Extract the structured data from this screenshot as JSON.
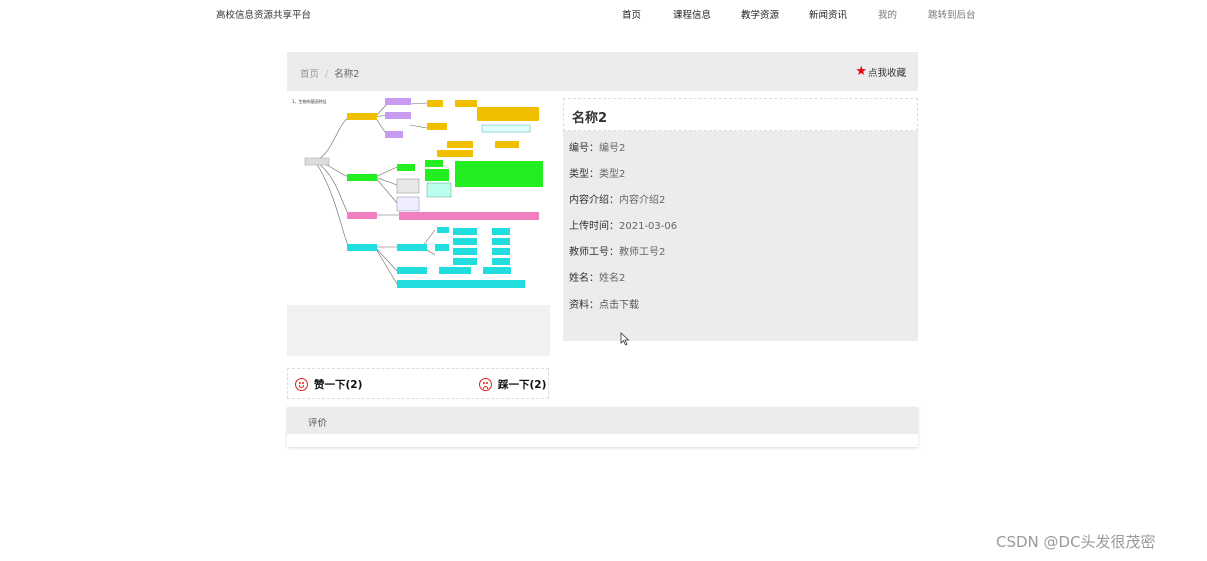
{
  "header": {
    "brand": "高校信息资源共享平台",
    "nav": [
      "首页",
      "课程信息",
      "教学资源",
      "新闻资讯",
      "我的",
      "跳转到后台"
    ]
  },
  "breadcrumb": {
    "home": "首页",
    "separator": "/",
    "current": "名称2",
    "favorite": "点我收藏"
  },
  "preview_image": {
    "heading": "1、生物的基因特征"
  },
  "votes": {
    "like": "赞一下(2)",
    "dislike": "踩一下(2)"
  },
  "detail": {
    "title": "名称2",
    "fields": [
      {
        "label": "编号：",
        "value": "编号2"
      },
      {
        "label": "类型：",
        "value": "类型2"
      },
      {
        "label": "内容介绍：",
        "value": "内容介绍2"
      },
      {
        "label": "上传时间：",
        "value": "2021-03-06"
      },
      {
        "label": "教师工号：",
        "value": "教师工号2"
      },
      {
        "label": "姓名：",
        "value": "姓名2"
      },
      {
        "label": "资料：",
        "value": "点击下载"
      }
    ]
  },
  "review": {
    "title": "评价"
  },
  "watermark": "CSDN @DC头发很茂密",
  "colors": {
    "star": "#e00000",
    "face": "#e02020",
    "panel": "#ececee"
  }
}
